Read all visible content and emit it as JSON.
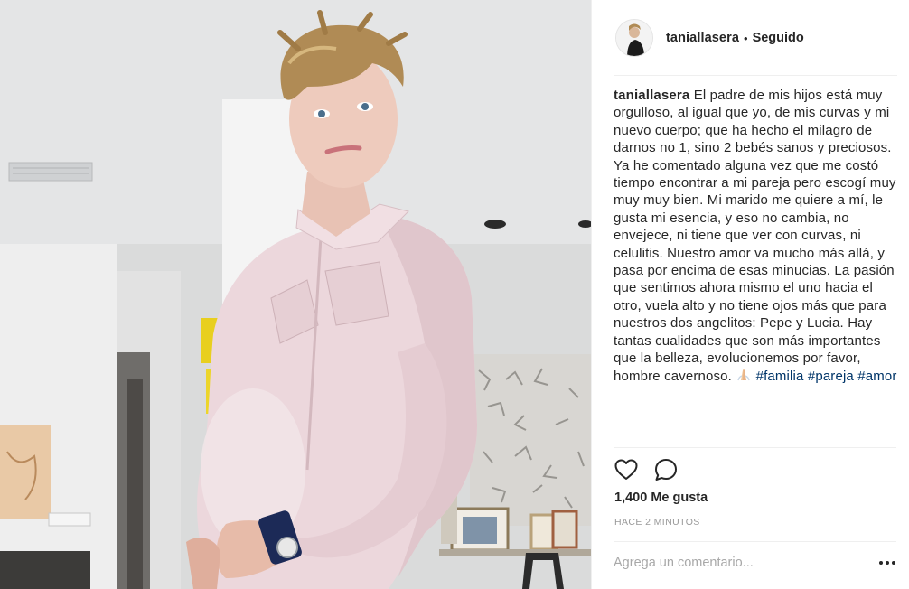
{
  "post": {
    "author": {
      "username": "taniallasera",
      "separator": "•",
      "follow_state": "Seguido"
    },
    "caption": {
      "username": "taniallasera",
      "text": "El padre de mis hijos está muy orgulloso, al igual que yo, de mis curvas y mi nuevo cuerpo; que ha hecho el milagro de darnos no 1, sino 2 bebés sanos y preciosos. Ya he comentado alguna vez que me costó tiempo encontrar a mi pareja pero escogí muy muy muy bien. Mi marido me quiere a mí, le gusta mi esencia, y eso no cambia, no envejece, ni tiene que ver con curvas, ni celulitis. Nuestro amor va mucho más allá, y pasa por encima de esas minucias. La pasión que sentimos ahora mismo el uno hacia el otro, vuela alto y no tiene ojos más que para nuestros dos angelitos: Pepe y Lucia. Hay tantas cualidades que son más importantes que la belleza, evolucionemos por favor, hombre cavernoso.",
      "emoji_icon": "praying-hands-icon",
      "hashtags": [
        "#familia",
        "#pareja",
        "#amor"
      ]
    },
    "actions": {
      "like_icon": "heart-icon",
      "comment_icon": "comment-bubble-icon"
    },
    "likes_text": "1,400 Me gusta",
    "timestamp": "HACE 2 MINUTOS",
    "comment_input": {
      "placeholder": "Agrega un comentario...",
      "value": ""
    },
    "more_icon": "more-options-icon"
  },
  "colors": {
    "text": "#262626",
    "hashtag": "#003569",
    "muted": "#999999",
    "divider": "#efefef"
  }
}
